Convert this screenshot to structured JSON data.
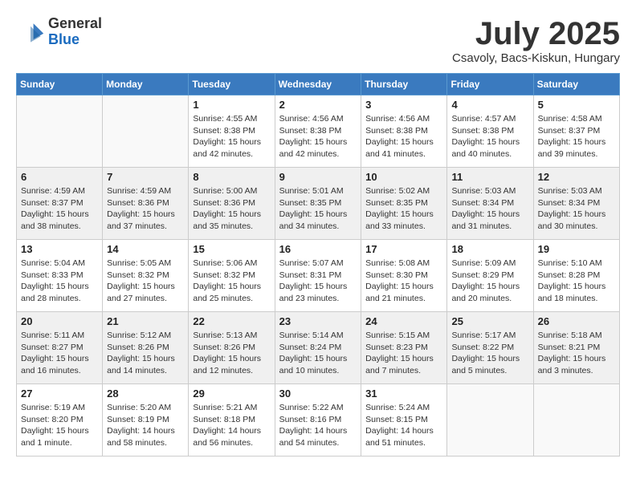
{
  "header": {
    "logo_general": "General",
    "logo_blue": "Blue",
    "month_title": "July 2025",
    "location": "Csavoly, Bacs-Kiskun, Hungary"
  },
  "days_of_week": [
    "Sunday",
    "Monday",
    "Tuesday",
    "Wednesday",
    "Thursday",
    "Friday",
    "Saturday"
  ],
  "weeks": [
    {
      "shaded": false,
      "days": [
        {
          "num": "",
          "info": ""
        },
        {
          "num": "",
          "info": ""
        },
        {
          "num": "1",
          "info": "Sunrise: 4:55 AM\nSunset: 8:38 PM\nDaylight: 15 hours and 42 minutes."
        },
        {
          "num": "2",
          "info": "Sunrise: 4:56 AM\nSunset: 8:38 PM\nDaylight: 15 hours and 42 minutes."
        },
        {
          "num": "3",
          "info": "Sunrise: 4:56 AM\nSunset: 8:38 PM\nDaylight: 15 hours and 41 minutes."
        },
        {
          "num": "4",
          "info": "Sunrise: 4:57 AM\nSunset: 8:38 PM\nDaylight: 15 hours and 40 minutes."
        },
        {
          "num": "5",
          "info": "Sunrise: 4:58 AM\nSunset: 8:37 PM\nDaylight: 15 hours and 39 minutes."
        }
      ]
    },
    {
      "shaded": true,
      "days": [
        {
          "num": "6",
          "info": "Sunrise: 4:59 AM\nSunset: 8:37 PM\nDaylight: 15 hours and 38 minutes."
        },
        {
          "num": "7",
          "info": "Sunrise: 4:59 AM\nSunset: 8:36 PM\nDaylight: 15 hours and 37 minutes."
        },
        {
          "num": "8",
          "info": "Sunrise: 5:00 AM\nSunset: 8:36 PM\nDaylight: 15 hours and 35 minutes."
        },
        {
          "num": "9",
          "info": "Sunrise: 5:01 AM\nSunset: 8:35 PM\nDaylight: 15 hours and 34 minutes."
        },
        {
          "num": "10",
          "info": "Sunrise: 5:02 AM\nSunset: 8:35 PM\nDaylight: 15 hours and 33 minutes."
        },
        {
          "num": "11",
          "info": "Sunrise: 5:03 AM\nSunset: 8:34 PM\nDaylight: 15 hours and 31 minutes."
        },
        {
          "num": "12",
          "info": "Sunrise: 5:03 AM\nSunset: 8:34 PM\nDaylight: 15 hours and 30 minutes."
        }
      ]
    },
    {
      "shaded": false,
      "days": [
        {
          "num": "13",
          "info": "Sunrise: 5:04 AM\nSunset: 8:33 PM\nDaylight: 15 hours and 28 minutes."
        },
        {
          "num": "14",
          "info": "Sunrise: 5:05 AM\nSunset: 8:32 PM\nDaylight: 15 hours and 27 minutes."
        },
        {
          "num": "15",
          "info": "Sunrise: 5:06 AM\nSunset: 8:32 PM\nDaylight: 15 hours and 25 minutes."
        },
        {
          "num": "16",
          "info": "Sunrise: 5:07 AM\nSunset: 8:31 PM\nDaylight: 15 hours and 23 minutes."
        },
        {
          "num": "17",
          "info": "Sunrise: 5:08 AM\nSunset: 8:30 PM\nDaylight: 15 hours and 21 minutes."
        },
        {
          "num": "18",
          "info": "Sunrise: 5:09 AM\nSunset: 8:29 PM\nDaylight: 15 hours and 20 minutes."
        },
        {
          "num": "19",
          "info": "Sunrise: 5:10 AM\nSunset: 8:28 PM\nDaylight: 15 hours and 18 minutes."
        }
      ]
    },
    {
      "shaded": true,
      "days": [
        {
          "num": "20",
          "info": "Sunrise: 5:11 AM\nSunset: 8:27 PM\nDaylight: 15 hours and 16 minutes."
        },
        {
          "num": "21",
          "info": "Sunrise: 5:12 AM\nSunset: 8:26 PM\nDaylight: 15 hours and 14 minutes."
        },
        {
          "num": "22",
          "info": "Sunrise: 5:13 AM\nSunset: 8:26 PM\nDaylight: 15 hours and 12 minutes."
        },
        {
          "num": "23",
          "info": "Sunrise: 5:14 AM\nSunset: 8:24 PM\nDaylight: 15 hours and 10 minutes."
        },
        {
          "num": "24",
          "info": "Sunrise: 5:15 AM\nSunset: 8:23 PM\nDaylight: 15 hours and 7 minutes."
        },
        {
          "num": "25",
          "info": "Sunrise: 5:17 AM\nSunset: 8:22 PM\nDaylight: 15 hours and 5 minutes."
        },
        {
          "num": "26",
          "info": "Sunrise: 5:18 AM\nSunset: 8:21 PM\nDaylight: 15 hours and 3 minutes."
        }
      ]
    },
    {
      "shaded": false,
      "days": [
        {
          "num": "27",
          "info": "Sunrise: 5:19 AM\nSunset: 8:20 PM\nDaylight: 15 hours and 1 minute."
        },
        {
          "num": "28",
          "info": "Sunrise: 5:20 AM\nSunset: 8:19 PM\nDaylight: 14 hours and 58 minutes."
        },
        {
          "num": "29",
          "info": "Sunrise: 5:21 AM\nSunset: 8:18 PM\nDaylight: 14 hours and 56 minutes."
        },
        {
          "num": "30",
          "info": "Sunrise: 5:22 AM\nSunset: 8:16 PM\nDaylight: 14 hours and 54 minutes."
        },
        {
          "num": "31",
          "info": "Sunrise: 5:24 AM\nSunset: 8:15 PM\nDaylight: 14 hours and 51 minutes."
        },
        {
          "num": "",
          "info": ""
        },
        {
          "num": "",
          "info": ""
        }
      ]
    }
  ]
}
